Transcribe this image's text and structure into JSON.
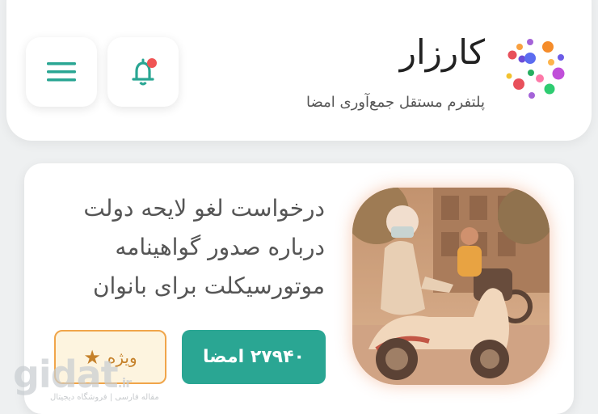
{
  "brand": {
    "name": "کارزار",
    "tagline": "پلتفرم مستقل جمع‌آوری امضا"
  },
  "header": {
    "menu_icon": "hamburger-menu-icon",
    "notification_icon": "bell-icon",
    "notification_dot_color": "#f05454"
  },
  "petition": {
    "title_lines": [
      "درخواست لغو لایحه دولت",
      "درباره صدور گواهینامه",
      "موتورسیکلت برای بانوان"
    ],
    "sign_label": "۲۷۹۴۰ امضا",
    "featured_label": "ویژه",
    "featured_icon": "star-icon",
    "image_icon": "motorcycle-women-photo"
  },
  "watermark": {
    "name": "gidat",
    "suffix": ".ir",
    "subtitle": "مقاله فارسی | فروشگاه دیجیتال"
  },
  "colors": {
    "accent_teal": "#2aa693",
    "featured_orange": "#f0a54a",
    "background": "#eef0f1"
  }
}
